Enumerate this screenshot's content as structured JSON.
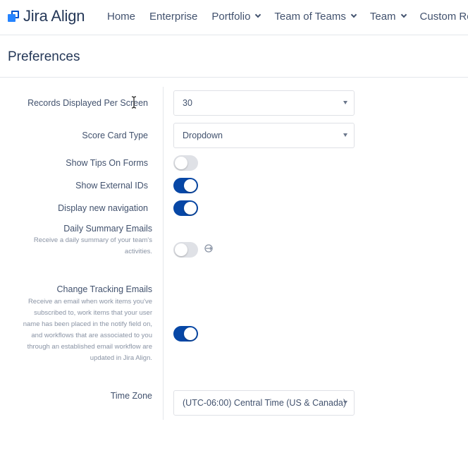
{
  "header": {
    "logo_text": "Jira Align",
    "nav": [
      {
        "label": "Home",
        "has_menu": false
      },
      {
        "label": "Enterprise",
        "has_menu": false
      },
      {
        "label": "Portfolio",
        "has_menu": true
      },
      {
        "label": "Team of Teams",
        "has_menu": true
      },
      {
        "label": "Team",
        "has_menu": true
      },
      {
        "label": "Custom Roo",
        "has_menu": false
      }
    ]
  },
  "page": {
    "title": "Preferences"
  },
  "preferences": {
    "records_per_screen": {
      "label": "Records Displayed Per Screen",
      "value": "30"
    },
    "score_card_type": {
      "label": "Score Card Type",
      "value": "Dropdown"
    },
    "show_tips": {
      "label": "Show Tips On Forms",
      "enabled": false
    },
    "show_external_ids": {
      "label": "Show External IDs",
      "enabled": true
    },
    "new_navigation": {
      "label": "Display new navigation",
      "enabled": true
    },
    "daily_summary": {
      "label": "Daily Summary Emails",
      "description_lines": [
        "Receive a daily summary of your team's",
        "activities."
      ],
      "enabled": false,
      "icon": "sync-icon"
    },
    "change_tracking": {
      "label": "Change Tracking Emails",
      "description_lines": [
        "Receive an email when work items you've",
        "subscribed to, work items that your user",
        "name has been placed in the notify field on,",
        "and workflows that are associated to you",
        "through an established email workflow are",
        "updated in Jira Align."
      ],
      "enabled": true
    },
    "time_zone": {
      "label": "Time Zone",
      "value": "(UTC-06:00) Central Time (US & Canada)"
    }
  },
  "colors": {
    "toggle_on": "#0747a6",
    "toggle_off": "#dfe1e6",
    "logo_blue": "#0052cc"
  }
}
